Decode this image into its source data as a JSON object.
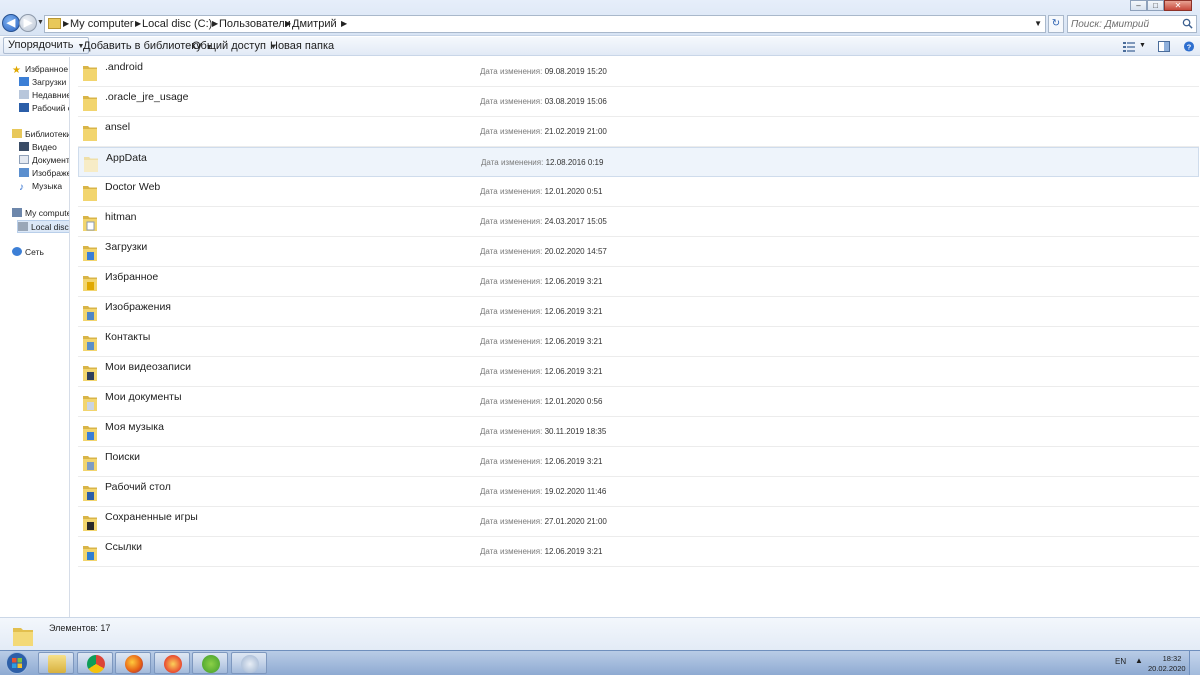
{
  "window": {
    "breadcrumb": [
      "My computer",
      "Local disc (C:)",
      "Пользователи",
      "Дмитрий"
    ],
    "search_placeholder": "Поиск: Дмитрий",
    "controls": {
      "minimize": "–",
      "maximize": "□",
      "close": "✕"
    }
  },
  "toolbar": {
    "organize": "Упорядочить",
    "add_library": "Добавить в библиотеку",
    "share": "Общий доступ",
    "new_folder": "Новая папка"
  },
  "nav": {
    "favorites": "Избранное",
    "fav_items": [
      "Загрузки",
      "Недавние места",
      "Рабочий стол"
    ],
    "libraries": "Библиотеки",
    "lib_items": [
      "Видео",
      "Документы",
      "Изображения",
      "Музыка"
    ],
    "computer": "My computer",
    "local_disc": "Local disc (C:)",
    "network": "Сеть"
  },
  "files": {
    "date_label": "Дата изменения:",
    "items": [
      {
        "name": ".android",
        "date": "09.08.2019 15:20",
        "icon": "folder-icon"
      },
      {
        "name": ".oracle_jre_usage",
        "date": "03.08.2019 15:06",
        "icon": "folder-icon"
      },
      {
        "name": "ansel",
        "date": "21.02.2019 21:00",
        "icon": "folder-icon"
      },
      {
        "name": "AppData",
        "date": "12.08.2016 0:19",
        "icon": "hidden-folder-icon"
      },
      {
        "name": "Doctor Web",
        "date": "12.01.2020 0:51",
        "icon": "folder-icon"
      },
      {
        "name": "hitman",
        "date": "24.03.2017 15:05",
        "icon": "document-folder-icon"
      },
      {
        "name": "Загрузки",
        "date": "20.02.2020 14:57",
        "icon": "downloads-folder-icon"
      },
      {
        "name": "Избранное",
        "date": "12.06.2019 3:21",
        "icon": "favorites-folder-icon"
      },
      {
        "name": "Изображения",
        "date": "12.06.2019 3:21",
        "icon": "pictures-folder-icon"
      },
      {
        "name": "Контакты",
        "date": "12.06.2019 3:21",
        "icon": "contacts-folder-icon"
      },
      {
        "name": "Мои видеозаписи",
        "date": "12.06.2019 3:21",
        "icon": "videos-folder-icon"
      },
      {
        "name": "Мои документы",
        "date": "12.01.2020 0:56",
        "icon": "documents-folder-icon"
      },
      {
        "name": "Моя музыка",
        "date": "30.11.2019 18:35",
        "icon": "music-folder-icon"
      },
      {
        "name": "Поиски",
        "date": "12.06.2019 3:21",
        "icon": "searches-folder-icon"
      },
      {
        "name": "Рабочий стол",
        "date": "19.02.2020 11:46",
        "icon": "desktop-folder-icon"
      },
      {
        "name": "Сохраненные игры",
        "date": "27.01.2020 21:00",
        "icon": "saved-games-folder-icon"
      },
      {
        "name": "Ссылки",
        "date": "12.06.2019 3:21",
        "icon": "links-folder-icon"
      }
    ],
    "selected_index": 3
  },
  "details": {
    "count": "Элементов: 17"
  },
  "taskbar": {
    "apps": [
      "explorer-icon",
      "chrome-icon",
      "firefox-icon",
      "yandex-browser-icon",
      "utorrent-icon",
      "paint-icon"
    ],
    "lang": "EN",
    "time": "18:32",
    "date": "20.02.2020"
  },
  "colors": {
    "accent": "#2a62c0",
    "folder": "#e8c85a",
    "selection": "#eef4fb"
  }
}
